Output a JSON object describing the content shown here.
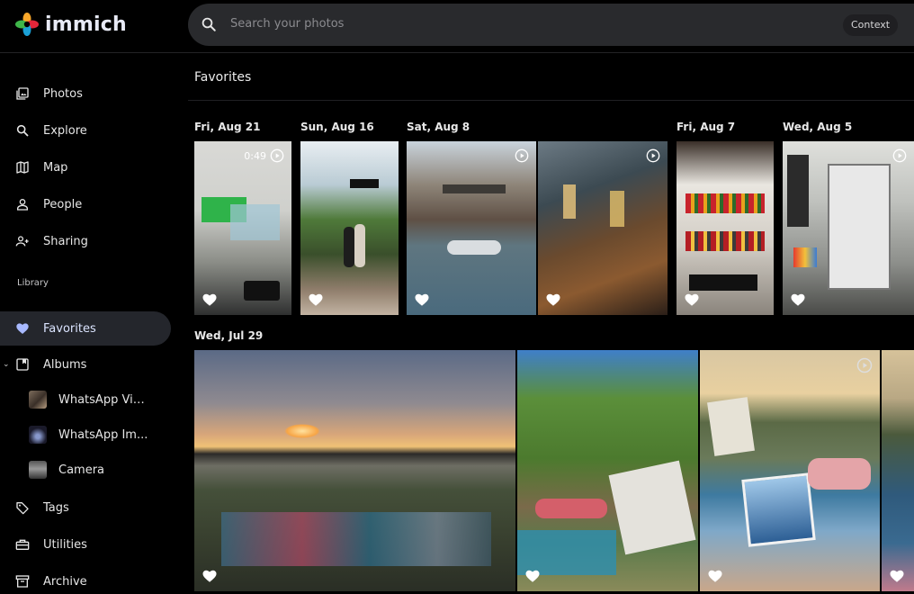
{
  "app": {
    "name": "immich"
  },
  "search": {
    "placeholder": "Search your photos",
    "context_label": "Context"
  },
  "sidebar": {
    "items": [
      {
        "label": "Photos",
        "icon": "photos-icon"
      },
      {
        "label": "Explore",
        "icon": "explore-icon"
      },
      {
        "label": "Map",
        "icon": "map-icon"
      },
      {
        "label": "People",
        "icon": "people-icon"
      },
      {
        "label": "Sharing",
        "icon": "sharing-icon"
      }
    ],
    "library_label": "Library",
    "library_items": [
      {
        "label": "Favorites",
        "icon": "heart-icon",
        "active": true
      },
      {
        "label": "Albums",
        "icon": "albums-icon"
      }
    ],
    "albums": [
      {
        "label": "WhatsApp Vid..."
      },
      {
        "label": "WhatsApp Im..."
      },
      {
        "label": "Camera"
      }
    ],
    "bottom_items": [
      {
        "label": "Tags",
        "icon": "tag-icon"
      },
      {
        "label": "Utilities",
        "icon": "utilities-icon"
      },
      {
        "label": "Archive",
        "icon": "archive-icon"
      }
    ]
  },
  "main": {
    "title": "Favorites",
    "groups": [
      {
        "date": "Fri, Aug 21"
      },
      {
        "date": "Sun, Aug 16"
      },
      {
        "date": "Sat, Aug 8"
      },
      {
        "date": "Fri, Aug 7"
      },
      {
        "date": "Wed, Aug 5"
      },
      {
        "date": "Wed, Jul 29"
      }
    ],
    "video_duration": "0:49"
  },
  "colors": {
    "accent": "#a8b9ff",
    "background": "#000000",
    "active_bg": "#24262c"
  }
}
